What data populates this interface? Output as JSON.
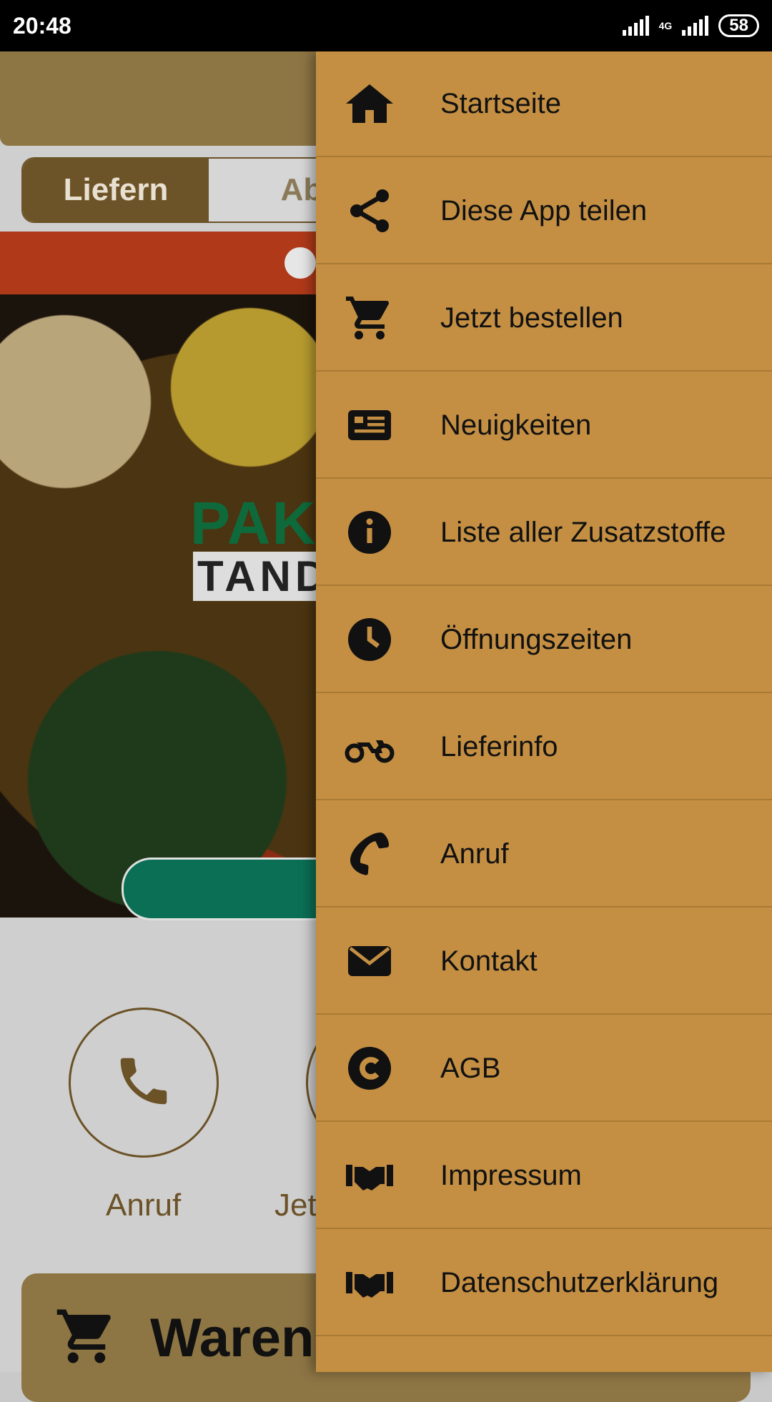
{
  "status_bar": {
    "time": "20:48",
    "network": "4G",
    "battery": "58"
  },
  "background": {
    "tabs": [
      "Liefern",
      "Ab"
    ],
    "logo_top": "PAK",
    "logo_bottom": "TAND",
    "actions": [
      {
        "label": "Anruf",
        "icon": "phone-icon"
      },
      {
        "label": "Jet",
        "icon": "cart-icon"
      }
    ],
    "cart_label": "Warenko"
  },
  "drawer": {
    "items": [
      {
        "label": "Startseite",
        "icon": "home-icon"
      },
      {
        "label": "Diese App teilen",
        "icon": "share-icon"
      },
      {
        "label": "Jetzt bestellen",
        "icon": "cart-icon"
      },
      {
        "label": "Neuigkeiten",
        "icon": "newspaper-icon"
      },
      {
        "label": "Liste aller Zusatzstoffe",
        "icon": "info-icon"
      },
      {
        "label": "Öffnungszeiten",
        "icon": "clock-icon"
      },
      {
        "label": "Lieferinfo",
        "icon": "motorcycle-icon"
      },
      {
        "label": "Anruf",
        "icon": "phone-icon"
      },
      {
        "label": "Kontakt",
        "icon": "envelope-icon"
      },
      {
        "label": "AGB",
        "icon": "copyright-icon"
      },
      {
        "label": "Impressum",
        "icon": "handshake-icon"
      },
      {
        "label": "Datenschutzerklärung",
        "icon": "handshake-icon"
      }
    ]
  },
  "colors": {
    "drawer_bg": "#c48f42",
    "header_bg": "#8d7544",
    "accent_dark": "#6d5428",
    "promo": "#b0391a",
    "hero_button": "#0b6f55"
  }
}
